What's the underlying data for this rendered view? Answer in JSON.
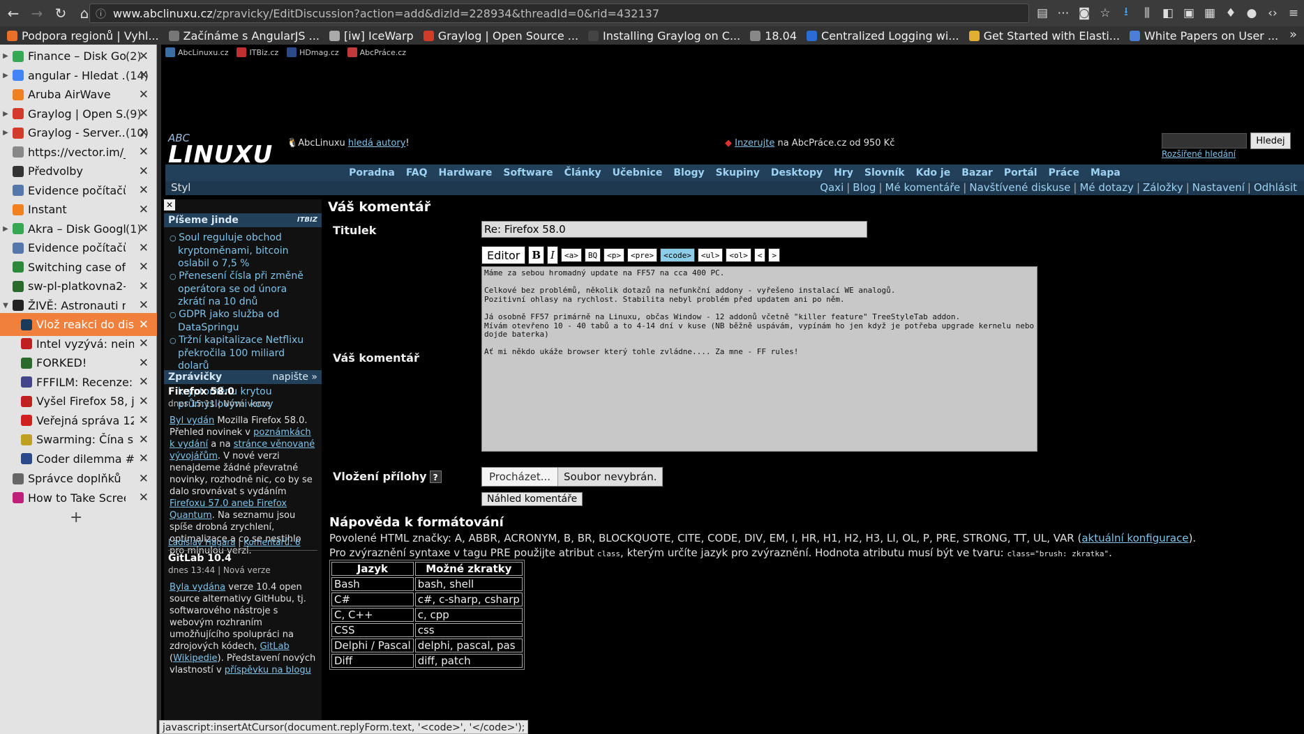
{
  "browser": {
    "url_host": "www.abclinuxu.cz",
    "url_path": "/zpravicky/EditDiscussion?action=add&dizId=228934&threadId=0&rid=432137",
    "bookmarks": [
      {
        "label": "Podpora regionů | Vyhl...",
        "color": "#e8702a"
      },
      {
        "label": "Začínáme s AngularJS ...",
        "color": "#777777"
      },
      {
        "label": "[iw] IceWarp",
        "color": "#aaaaaa"
      },
      {
        "label": "Graylog | Open Source ...",
        "color": "#d23a2a"
      },
      {
        "label": "Installing Graylog on C...",
        "color": "#444444"
      },
      {
        "label": "18.04",
        "color": "#888888"
      },
      {
        "label": "Centralized Logging wi...",
        "color": "#2a6cd2"
      },
      {
        "label": "Get Started with Elasti...",
        "color": "#e0b030"
      },
      {
        "label": "White Papers on User ...",
        "color": "#4a7ed8"
      }
    ],
    "status_text": "javascript:insertAtCursor(document.replyForm.text, '<code>', '</code>');"
  },
  "tabs": [
    {
      "label": "Finance – Disk Go..",
      "count": "(2)",
      "twisty": "▶",
      "color": "#34a853",
      "child": false
    },
    {
      "label": "angular - Hledat ..",
      "count": "(14)",
      "twisty": "▶",
      "color": "#4285f4",
      "child": false
    },
    {
      "label": "Aruba AirWave",
      "count": "",
      "twisty": "",
      "color": "#f08020",
      "child": false
    },
    {
      "label": "Graylog | Open S..",
      "count": "(9)",
      "twisty": "▶",
      "color": "#d23a2a",
      "child": false
    },
    {
      "label": "Graylog - Server..",
      "count": "(10)",
      "twisty": "▶",
      "color": "#d23a2a",
      "child": false
    },
    {
      "label": "https://vector.im/_...",
      "count": "",
      "twisty": "",
      "color": "#888888",
      "child": false
    },
    {
      "label": "Předvolby",
      "count": "",
      "twisty": "",
      "color": "#333333",
      "child": false
    },
    {
      "label": "Evidence počítačů",
      "count": "",
      "twisty": "",
      "color": "#5577aa",
      "child": false
    },
    {
      "label": "Instant",
      "count": "",
      "twisty": "",
      "color": "#f08020",
      "child": false
    },
    {
      "label": "Akra – Disk Google",
      "count": "(1)",
      "twisty": "▶",
      "color": "#34a853",
      "child": false
    },
    {
      "label": "Evidence počítačů",
      "count": "",
      "twisty": "",
      "color": "#5577aa",
      "child": false
    },
    {
      "label": "Switching case of ch..",
      "count": "",
      "twisty": "",
      "color": "#2a8a3a",
      "child": false
    },
    {
      "label": "sw-pl-platkovna2-1...",
      "count": "",
      "twisty": "",
      "color": "#2a6a2a",
      "child": false
    },
    {
      "label": "ŽIVĚ: Astronauti mě..",
      "count": "",
      "twisty": "▼",
      "color": "#222222",
      "child": false
    },
    {
      "label": "Vlož reakci do disk..",
      "count": "",
      "twisty": "",
      "color": "#1a3a5a",
      "child": true,
      "active": true
    },
    {
      "label": "Intel vyzývá: neinš..",
      "count": "",
      "twisty": "",
      "color": "#c02020",
      "child": true
    },
    {
      "label": "FORKED!",
      "count": "",
      "twisty": "",
      "color": "#2a6a2a",
      "child": true
    },
    {
      "label": "FFFILM: Recenze: ..",
      "count": "",
      "twisty": "",
      "color": "#444488",
      "child": true
    },
    {
      "label": "Vyšel Firefox 58, j..",
      "count": "",
      "twisty": "",
      "color": "#c02020",
      "child": true
    },
    {
      "label": "Veřejná správa 12/..",
      "count": "",
      "twisty": "",
      "color": "#d02020",
      "child": true
    },
    {
      "label": "Swarming: Čína se..",
      "count": "",
      "twisty": "",
      "color": "#c0a020",
      "child": true
    },
    {
      "label": "Coder dilemma #1..",
      "count": "",
      "twisty": "",
      "color": "#2a4a8a",
      "child": true
    },
    {
      "label": "Správce doplňků",
      "count": "",
      "twisty": "",
      "color": "#666666",
      "child": false
    },
    {
      "label": "How to Take Screen..",
      "count": "",
      "twisty": "",
      "color": "#c0207a",
      "child": false
    }
  ],
  "newtab_label": "+",
  "site": {
    "top_links": [
      "AbcLinuxu.cz",
      "ITBiz.cz",
      "HDmag.cz",
      "AbcPráce.cz"
    ],
    "logo_abc": "ABC",
    "logo_linux": "LINUXU",
    "authors_prefix": "AbcLinuxu ",
    "authors_link": "hledá autory",
    "authors_suffix": "!",
    "ad_link": "Inzerujte",
    "ad_suffix": " na AbcPráce.cz od 950 Kč",
    "search_button": "Hledej",
    "advanced_search": "Rozšířené hledání",
    "menu": [
      "Poradna",
      "FAQ",
      "Hardware",
      "Software",
      "Články",
      "Učebnice",
      "Blogy",
      "Skupiny",
      "Desktopy",
      "Hry",
      "Slovník",
      "Kdo je",
      "Bazar",
      "Portál",
      "Práce",
      "Mapa"
    ],
    "style_label": "Styl",
    "user_links": [
      "Qaxi",
      "Blog",
      "Mé komentáře",
      "Navštívené diskuse",
      "Mé dotazy",
      "Záložky",
      "Nastavení",
      "Odhlásit"
    ]
  },
  "leftcol": {
    "close": "✕",
    "jinde_title": "Píšeme jinde",
    "jinde_badge": "ITBIZ",
    "jinde_items": [
      "Soul reguluje obchod kryptoměnami, bitcoin oslabil o 7,5 %",
      "Přenesení čísla při změně operátora se od února zkrátí na 10 dnů",
      "GDPR jako služba od DataSpringu",
      "Tržní kapitalizace Netflixu překročila 100 miliard dolarů",
      "Švýcarský fond chce vydat kryptoměnu krytou průmyslovými kovy"
    ],
    "news_title": "Zprávičky",
    "news_write": "napište »",
    "news1": {
      "title": "Firefox 58.0",
      "date": "dnes 15:11 | Nová verze",
      "l1": "Byl vydán",
      "t1": " Mozilla Firefox 58.0. Přehled novinek v ",
      "l2": "poznámkách k vydání",
      "t2": " a na ",
      "l3": "stránce věnované vývojářům",
      "t3": ". V nové verzi nenajdeme žádné převratné novinky, rozhodně nic, co by se dalo srovnávat s vydáním ",
      "l4": "Firefoxu 57.0 aneb Firefox Quantum",
      "t4": ". Na seznamu jsou spíše drobná zrychlení, optimalizace a co se nestihlo pro minulou verzi.",
      "author": "Ladislav Hagara",
      "comments": "Komentářů: 6"
    },
    "news2": {
      "title": "GitLab 10.4",
      "date": "dnes 13:44 | Nová verze",
      "l1": "Byla vydána",
      "t1": " verze 10.4 open source alternativy GitHubu, tj. softwarového nástroje s webovým rozhraním umožňujícího spolupráci na zdrojových kódech, ",
      "l2": "GitLab",
      "t2": " (",
      "l3": "Wikipedie",
      "t3": "). Představení nových vlastností v ",
      "l4": "příspěvku na blogu"
    }
  },
  "form": {
    "heading": "Váš komentář",
    "title_label": "Titulek",
    "title_value": "Re: Firefox 58.0",
    "comment_label": "Váš komentář",
    "toolbar": [
      "Editor",
      "B",
      "I",
      "<a>",
      "BQ",
      "<p>",
      "<pre>",
      "<code>",
      "<ul>",
      "<ol>",
      "<",
      ">"
    ],
    "comment_text": "Máme za sebou hromadný update na FF57 na cca 400 PC.\n\nCelkové bez problémů, několik dotazů na nefunkční addony - vyřešeno instalací WE analogů.\nPozitivní ohlasy na rychlost. Stabilita nebyl problém před updatem ani po něm.\n\nJá osobně FF57 primárně na Linuxu, občas Window - 12 addonů včetně \"killer feature\" TreeStyleTab addon.\nMívám otevřeno 10 - 40 tabů a to 4-14 dní v kuse (NB běžně uspávám, vypínám ho jen když je potřeba upgrade kernelu nebo dojde baterka)\n\nAť mi někdo ukáže browser který tohle zvládne.... Za mne - FF rules!",
    "attach_label": "Vložení přílohy",
    "help_mark": "?",
    "browse_button": "Procházet...",
    "file_status": "Soubor nevybrán.",
    "preview_button": "Náhled komentáře"
  },
  "help": {
    "heading": "Nápověda k formátování",
    "allowed_prefix": "Povolené HTML značky: A, ABBR, ACRONYM, B, BR, BLOCKQUOTE, CITE, CODE, DIV, EM, I, HR, H1, H2, H3, LI, OL, P, PRE, STRONG, TT, UL, VAR (",
    "allowed_link": "aktuální konfigurace",
    "allowed_suffix": ").",
    "syntax_prefix": "Pro zvýraznění syntaxe v tagu PRE použijte atribut ",
    "syntax_code1": "class",
    "syntax_mid": ", kterým určíte jazyk pro zvýraznění. Hodnota atributu musí být ve tvaru: ",
    "syntax_code2": "class=\"brush: zkratka\"",
    "syntax_suffix": ".",
    "table_headers": [
      "Jazyk",
      "Možné zkratky"
    ],
    "table_rows": [
      [
        "Bash",
        "bash, shell"
      ],
      [
        "C#",
        "c#, c-sharp, csharp"
      ],
      [
        "C, C++",
        "c, cpp"
      ],
      [
        "CSS",
        "css"
      ],
      [
        "Delphi / Pascal",
        "delphi, pascal, pas"
      ],
      [
        "Diff",
        "diff, patch"
      ]
    ]
  }
}
